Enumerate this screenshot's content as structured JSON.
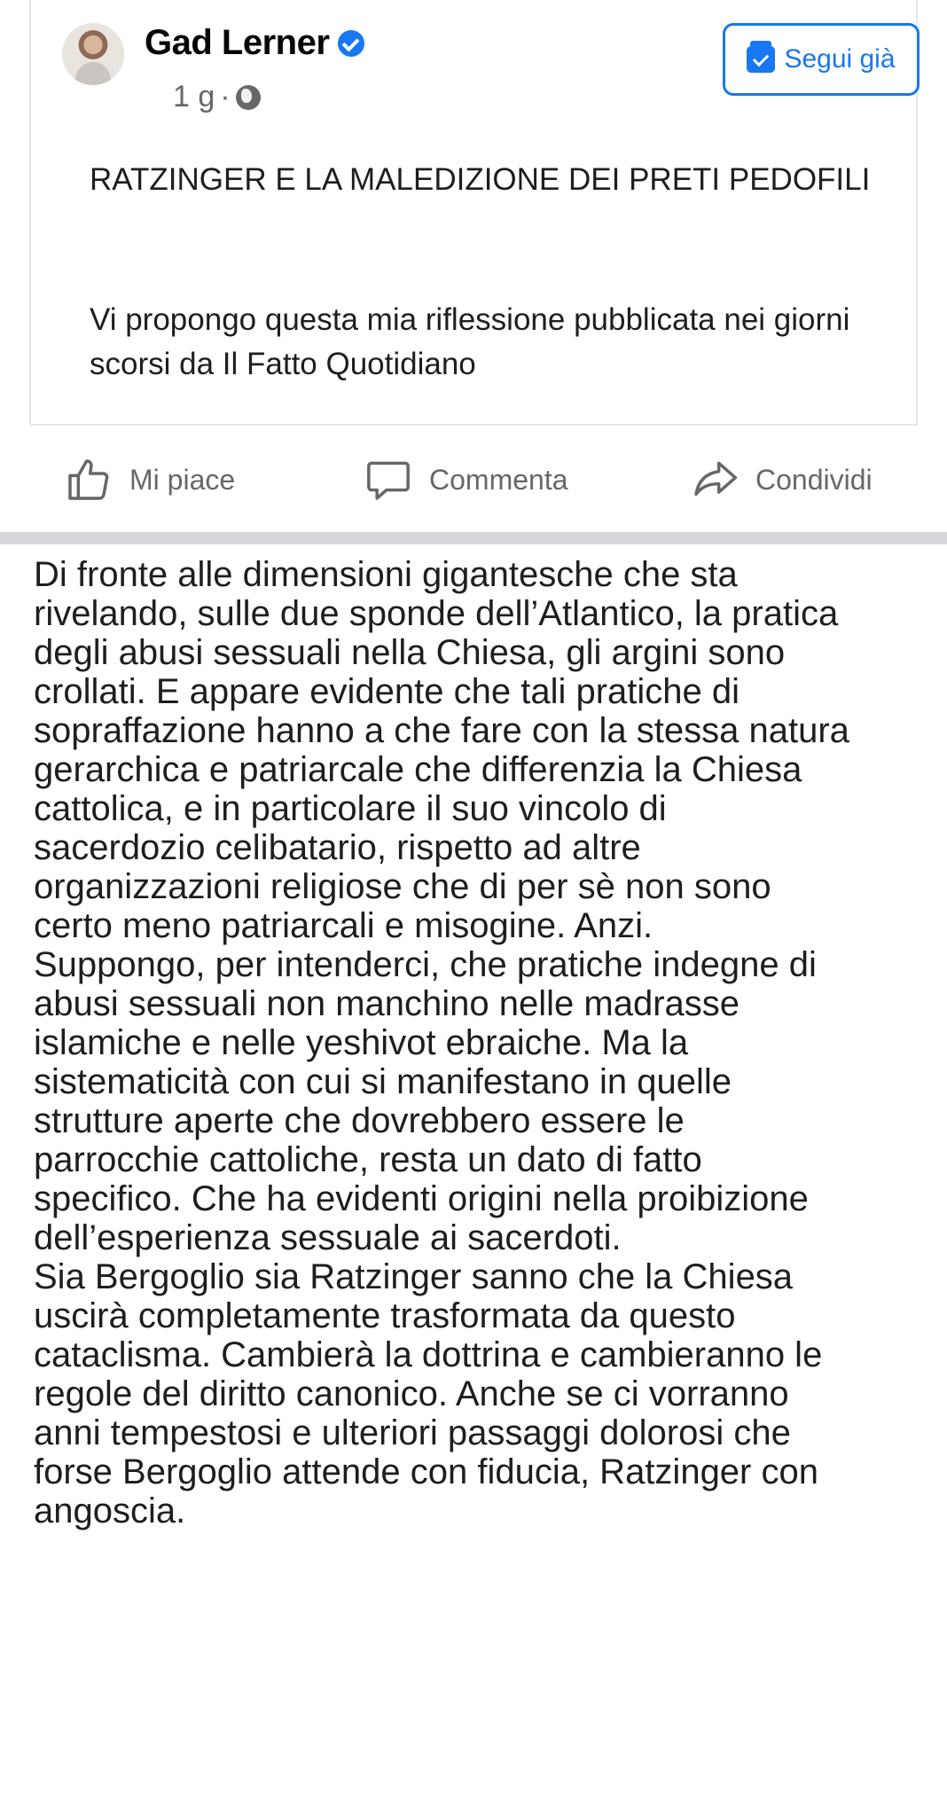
{
  "post": {
    "author": "Gad Lerner",
    "time": "1 g",
    "separator": "·",
    "follow_label": "Segui già",
    "title": "RATZINGER E LA MALEDIZIONE DEI PRETI PEDOFILI",
    "intro": "Vi propongo questa mia riflessione pubblicata nei giorni scorsi da Il Fatto Quotidiano"
  },
  "actions": {
    "like": "Mi piace",
    "comment": "Commenta",
    "share": "Condividi"
  },
  "article": {
    "lines": [
      "Di fronte alle dimensioni gigantesche che sta",
      "rivelando, sulle due sponde dell’Atlantico, la pratica",
      "degli abusi sessuali nella Chiesa, gli argini sono",
      "crollati. E appare evidente che tali pratiche di",
      "sopraffazione hanno a che fare con la stessa natura",
      "gerarchica e patriarcale che differenzia la Chiesa",
      "cattolica, e in particolare il suo vincolo di",
      "sacerdozio celibatario, rispetto ad altre",
      "organizzazioni religiose che di per sè non sono",
      "certo meno patriarcali e misogine. Anzi.",
      "Suppongo, per intenderci, che pratiche indegne di",
      "abusi sessuali non manchino nelle madrasse",
      "islamiche e nelle yeshivot ebraiche. Ma la",
      "sistematicità con cui si manifestano in quelle",
      "strutture aperte che dovrebbero essere le",
      "parrocchie cattoliche, resta un dato di fatto",
      "specifico. Che ha evidenti origini nella proibizione",
      "dell’esperienza sessuale ai sacerdoti.",
      "Sia Bergoglio sia Ratzinger sanno che la Chiesa",
      "uscirà completamente trasformata da questo",
      "cataclisma. Cambierà la dottrina e cambieranno le",
      "regole del diritto canonico. Anche se ci vorranno",
      "anni tempestosi e ulteriori passaggi dolorosi che",
      "forse Bergoglio attende con fiducia, Ratzinger con",
      "angoscia."
    ]
  },
  "colors": {
    "accent": "#1877f2",
    "text": "#1c1e21",
    "secondary": "#65676b",
    "divider": "#d7d8db"
  }
}
